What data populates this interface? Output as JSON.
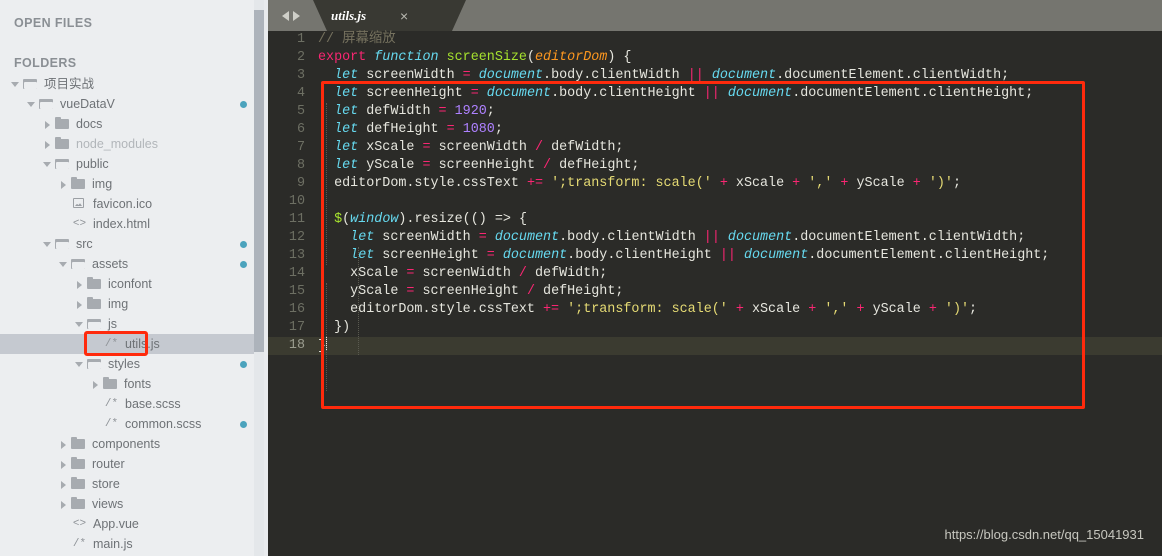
{
  "sidebar": {
    "open_files_title": "OPEN FILES",
    "folders_title": "FOLDERS",
    "tree": [
      {
        "label": "项目实战",
        "indent": 0,
        "type": "folder-open",
        "arrow": "open",
        "dot": false,
        "selected": false,
        "dim": false
      },
      {
        "label": "vueDataV",
        "indent": 1,
        "type": "folder-open",
        "arrow": "open",
        "dot": true,
        "selected": false,
        "dim": false
      },
      {
        "label": "docs",
        "indent": 2,
        "type": "folder-closed",
        "arrow": "closed",
        "dot": false,
        "selected": false,
        "dim": false
      },
      {
        "label": "node_modules",
        "indent": 2,
        "type": "folder-closed",
        "arrow": "closed",
        "dot": false,
        "selected": false,
        "dim": true
      },
      {
        "label": "public",
        "indent": 2,
        "type": "folder-open",
        "arrow": "open",
        "dot": false,
        "selected": false,
        "dim": false
      },
      {
        "label": "img",
        "indent": 3,
        "type": "folder-closed",
        "arrow": "closed",
        "dot": false,
        "selected": false,
        "dim": false
      },
      {
        "label": "favicon.ico",
        "indent": 3,
        "type": "file-image",
        "arrow": "none",
        "dot": false,
        "selected": false,
        "dim": false,
        "icon": "image-file-icon"
      },
      {
        "label": "index.html",
        "indent": 3,
        "type": "file-html",
        "arrow": "none",
        "dot": false,
        "selected": false,
        "dim": false,
        "icon": "<>"
      },
      {
        "label": "src",
        "indent": 2,
        "type": "folder-open",
        "arrow": "open",
        "dot": true,
        "selected": false,
        "dim": false
      },
      {
        "label": "assets",
        "indent": 3,
        "type": "folder-open",
        "arrow": "open",
        "dot": true,
        "selected": false,
        "dim": false
      },
      {
        "label": "iconfont",
        "indent": 4,
        "type": "folder-closed",
        "arrow": "closed",
        "dot": false,
        "selected": false,
        "dim": false
      },
      {
        "label": "img",
        "indent": 4,
        "type": "folder-closed",
        "arrow": "closed",
        "dot": false,
        "selected": false,
        "dim": false
      },
      {
        "label": "js",
        "indent": 4,
        "type": "folder-open",
        "arrow": "open",
        "dot": false,
        "selected": false,
        "dim": false
      },
      {
        "label": "utils.js",
        "indent": 5,
        "type": "file-js",
        "arrow": "none",
        "dot": false,
        "selected": true,
        "dim": false,
        "icon": "/*"
      },
      {
        "label": "styles",
        "indent": 4,
        "type": "folder-open",
        "arrow": "open",
        "dot": true,
        "selected": false,
        "dim": false
      },
      {
        "label": "fonts",
        "indent": 5,
        "type": "folder-closed",
        "arrow": "closed",
        "dot": false,
        "selected": false,
        "dim": false
      },
      {
        "label": "base.scss",
        "indent": 5,
        "type": "file-js",
        "arrow": "none",
        "dot": false,
        "selected": false,
        "dim": false,
        "icon": "/*"
      },
      {
        "label": "common.scss",
        "indent": 5,
        "type": "file-js",
        "arrow": "none",
        "dot": true,
        "selected": false,
        "dim": false,
        "icon": "/*"
      },
      {
        "label": "components",
        "indent": 3,
        "type": "folder-closed",
        "arrow": "closed",
        "dot": false,
        "selected": false,
        "dim": false
      },
      {
        "label": "router",
        "indent": 3,
        "type": "folder-closed",
        "arrow": "closed",
        "dot": false,
        "selected": false,
        "dim": false
      },
      {
        "label": "store",
        "indent": 3,
        "type": "folder-closed",
        "arrow": "closed",
        "dot": false,
        "selected": false,
        "dim": false
      },
      {
        "label": "views",
        "indent": 3,
        "type": "folder-closed",
        "arrow": "closed",
        "dot": false,
        "selected": false,
        "dim": false
      },
      {
        "label": "App.vue",
        "indent": 3,
        "type": "file-html",
        "arrow": "none",
        "dot": false,
        "selected": false,
        "dim": false,
        "icon": "<>"
      },
      {
        "label": "main.js",
        "indent": 3,
        "type": "file-js",
        "arrow": "none",
        "dot": false,
        "selected": false,
        "dim": false,
        "icon": "/*"
      }
    ]
  },
  "tabbar": {
    "prev_icon": "arrow-left-icon",
    "next_icon": "arrow-right-icon",
    "tabs": [
      {
        "title": "utils.js",
        "close_label": "×",
        "active": true
      }
    ]
  },
  "editor": {
    "active_line": 18,
    "line_numbers": [
      "1",
      "2",
      "3",
      "4",
      "5",
      "6",
      "7",
      "8",
      "9",
      "10",
      "11",
      "12",
      "13",
      "14",
      "15",
      "16",
      "17",
      "18"
    ],
    "lines": [
      {
        "n": 1,
        "text": "// 屏幕缩放"
      },
      {
        "n": 2,
        "text": "export function screenSize(editorDom) {"
      },
      {
        "n": 3,
        "text": "  let screenWidth = document.body.clientWidth || document.documentElement.clientWidth;"
      },
      {
        "n": 4,
        "text": "  let screenHeight = document.body.clientHeight || document.documentElement.clientHeight;"
      },
      {
        "n": 5,
        "text": "  let defWidth = 1920;"
      },
      {
        "n": 6,
        "text": "  let defHeight = 1080;"
      },
      {
        "n": 7,
        "text": "  let xScale = screenWidth / defWidth;"
      },
      {
        "n": 8,
        "text": "  let yScale = screenHeight / defHeight;"
      },
      {
        "n": 9,
        "text": "  editorDom.style.cssText += ';transform: scale(' + xScale + ',' + yScale + ')';"
      },
      {
        "n": 10,
        "text": ""
      },
      {
        "n": 11,
        "text": "  $(window).resize(() => {"
      },
      {
        "n": 12,
        "text": "    let screenWidth = document.body.clientWidth || document.documentElement.clientWidth;"
      },
      {
        "n": 13,
        "text": "    let screenHeight = document.body.clientHeight || document.documentElement.clientHeight;"
      },
      {
        "n": 14,
        "text": "    xScale = screenWidth / defWidth;"
      },
      {
        "n": 15,
        "text": "    yScale = screenHeight / defHeight;"
      },
      {
        "n": 16,
        "text": "    editorDom.style.cssText += ';transform: scale(' + xScale + ',' + yScale + ')';"
      },
      {
        "n": 17,
        "text": "  })"
      },
      {
        "n": 18,
        "text": "}"
      }
    ]
  },
  "annotations": {
    "code_box_color": "#ff2a0c",
    "sidebar_box_color": "#ff2a0c"
  },
  "watermark": "https://blog.csdn.net/qq_15041931",
  "colors": {
    "sidebar_bg": "#eceef0",
    "editor_bg": "#2b2b28",
    "tabbar_bg": "#75756f",
    "tab_active_bg": "#393933",
    "accent_dot": "#4ba3bd",
    "selection_bg": "#c5c9d0"
  }
}
